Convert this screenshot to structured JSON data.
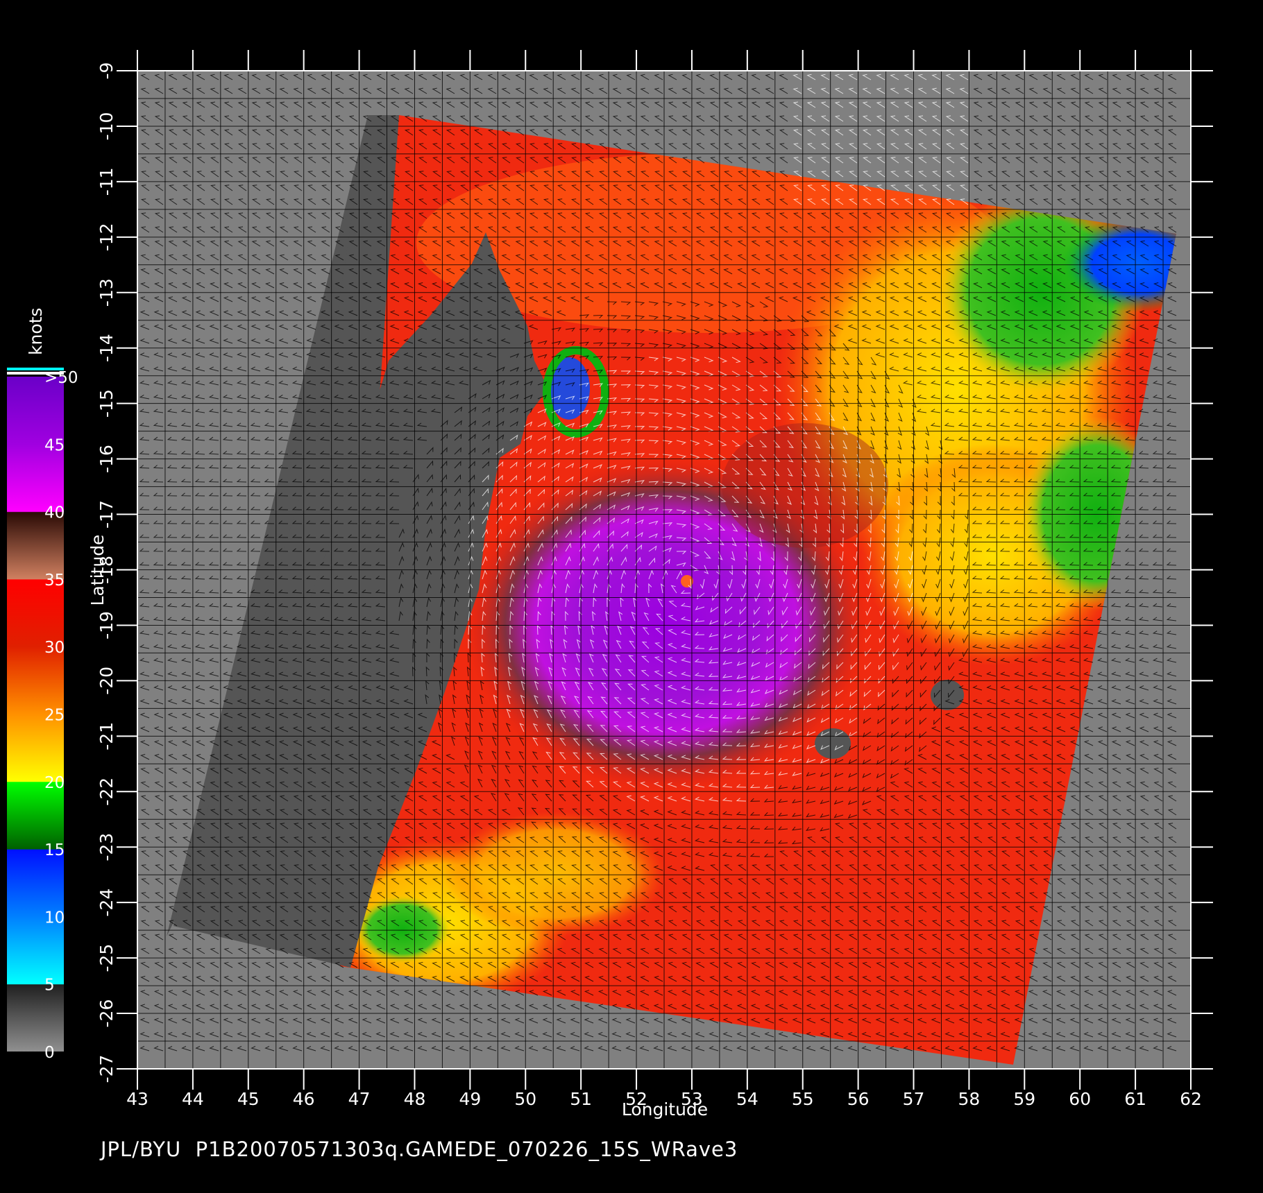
{
  "map": {
    "xlabel": "Longitude",
    "ylabel": "Latitude",
    "lon_ticks": [
      "43",
      "44",
      "45",
      "46",
      "47",
      "48",
      "49",
      "50",
      "51",
      "52",
      "53",
      "54",
      "55",
      "56",
      "57",
      "58",
      "59",
      "60",
      "61",
      "62"
    ],
    "lat_ticks": [
      "-9",
      "-10",
      "-11",
      "-12",
      "-13",
      "-14",
      "-15",
      "-16",
      "-17",
      "-18",
      "-19",
      "-20",
      "-21",
      "-22",
      "-23",
      "-24",
      "-25",
      "-26",
      "-27"
    ],
    "lon_range": [
      43,
      62
    ],
    "lat_range": [
      -27,
      -9
    ],
    "cyclone_center": {
      "lon": 52.9,
      "lat": -18.2
    },
    "islands": [
      {
        "lon": 55.5,
        "lat": -21.1
      },
      {
        "lon": 57.6,
        "lat": -20.2
      }
    ],
    "land_color": "#555555",
    "background_color": "#808080"
  },
  "colorbar": {
    "unit": "knots",
    "labels": [
      ">50",
      "45",
      "40",
      "35",
      "30",
      "25",
      "20",
      "15",
      "10",
      "5",
      "0"
    ],
    "colors": {
      "gt50": "#7a00d0",
      "c45": "#b000e0",
      "c40": "#ff00ff",
      "c35": "#4a1a10",
      "c35b": "#c07050",
      "c30": "#ff0000",
      "c25": "#ff6000",
      "c20": "#ffe000",
      "c15": "#00c000",
      "c10": "#0040ff",
      "c5": "#00e0ff",
      "c0": "#404040"
    }
  },
  "footer": {
    "source": "JPL/BYU",
    "product": "P1B20070571303q.GAMEDE_070226_15S_WRave3"
  }
}
